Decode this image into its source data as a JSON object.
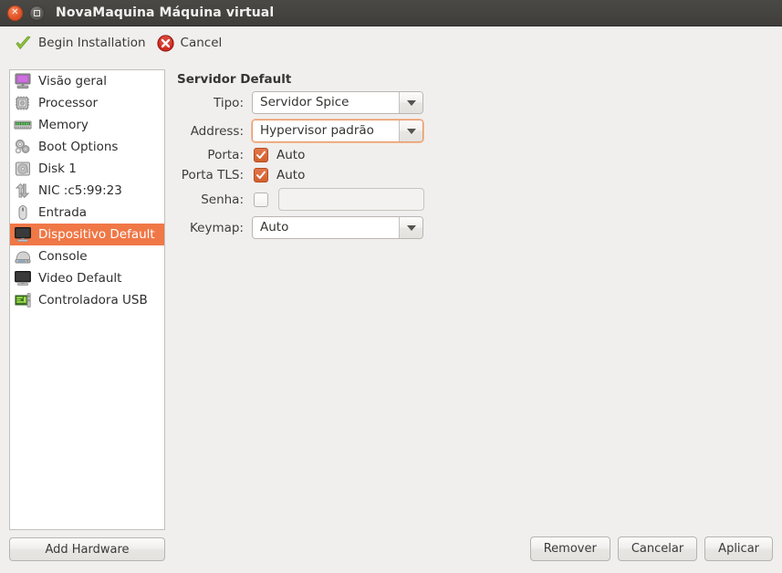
{
  "window": {
    "title": "NovaMaquina Máquina virtual",
    "close_icon": "close-icon",
    "maximize_icon": "maximize-icon",
    "titlebar_color": "#3f3e3b"
  },
  "toolbar": {
    "items": [
      {
        "label": "Begin Installation",
        "icon": "green-check-icon"
      },
      {
        "label": "Cancel",
        "icon": "red-cross-icon"
      }
    ]
  },
  "sidebar": {
    "items": [
      {
        "label": "Visão geral",
        "icon": "monitor-icon",
        "selected": false
      },
      {
        "label": "Processor",
        "icon": "cpu-chip-icon",
        "selected": false
      },
      {
        "label": "Memory",
        "icon": "memory-stick-icon",
        "selected": false
      },
      {
        "label": "Boot Options",
        "icon": "gears-icon",
        "selected": false
      },
      {
        "label": "Disk 1",
        "icon": "hard-disk-icon",
        "selected": false
      },
      {
        "label": "NIC :c5:99:23",
        "icon": "network-arrows-icon",
        "selected": false
      },
      {
        "label": "Entrada",
        "icon": "mouse-icon",
        "selected": false
      },
      {
        "label": "Dispositivo Default",
        "icon": "display-icon",
        "selected": true
      },
      {
        "label": "Console",
        "icon": "console-icon",
        "selected": false
      },
      {
        "label": "Video Default",
        "icon": "display-icon",
        "selected": false
      },
      {
        "label": "Controladora USB",
        "icon": "usb-card-icon",
        "selected": false
      }
    ],
    "selection_color": "#f07746",
    "add_hardware_label": "Add Hardware"
  },
  "main": {
    "heading": "Servidor Default",
    "fields": {
      "tipo": {
        "label": "Tipo:",
        "value": "Servidor Spice",
        "focused": false
      },
      "address": {
        "label": "Address:",
        "value": "Hypervisor padrão",
        "focused": true
      },
      "porta": {
        "label": "Porta:",
        "checkbox_label": "Auto",
        "checked": true
      },
      "porta_tls": {
        "label": "Porta TLS:",
        "checkbox_label": "Auto",
        "checked": true
      },
      "senha": {
        "label": "Senha:",
        "checked": false,
        "value": "",
        "placeholder": ""
      },
      "keymap": {
        "label": "Keymap:",
        "value": "Auto",
        "focused": false
      }
    }
  },
  "footer": {
    "buttons": [
      {
        "label": "Remover"
      },
      {
        "label": "Cancelar"
      },
      {
        "label": "Aplicar"
      }
    ]
  }
}
